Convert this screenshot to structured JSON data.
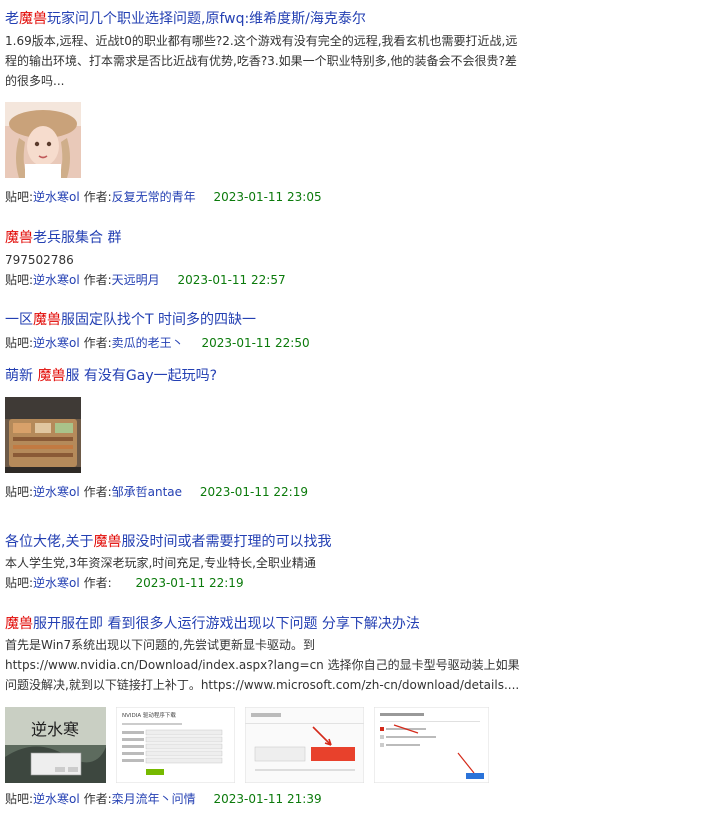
{
  "label_forum": "贴吧:",
  "label_author": "作者:",
  "posts": [
    {
      "title": [
        "老",
        "魔兽",
        "玩家问几个职业选择问题,原fwq:维希度斯/海克泰尔"
      ],
      "summary": "1.69版本,远程、近战t0的职业都有哪些?2.这个游戏有没有完全的远程,我看玄机也需要打近战,远程的输出环境、打本需求是否比近战有优势,吃香?3.如果一个职业特别多,他的装备会不会很贵?差的很多吗...",
      "forum": "逆水寒ol",
      "author": "反复无常的青年",
      "date": "2023-01-11 23:05"
    },
    {
      "title": [
        "",
        "魔兽",
        "老兵服集合 群"
      ],
      "summary": "797502786",
      "forum": "逆水寒ol",
      "author": "天远明月",
      "date": "2023-01-11 22:57"
    },
    {
      "title": [
        "一区",
        "魔兽",
        "服固定队找个T 时间多的四缺一"
      ],
      "summary": "",
      "forum": "逆水寒ol",
      "author": "卖瓜的老王丶",
      "date": "2023-01-11 22:50"
    },
    {
      "title": [
        "萌新 ",
        "魔兽",
        "服 有没有Gay一起玩吗?"
      ],
      "summary": "",
      "forum": "逆水寒ol",
      "author": "邹承哲antae",
      "date": "2023-01-11 22:19"
    },
    {
      "title": [
        "各位大佬,关于",
        "魔兽",
        "服没时间或者需要打理的可以找我"
      ],
      "summary": "本人学生党,3年资深老玩家,时间充足,专业特长,全职业精通",
      "forum": "逆水寒ol",
      "author": "",
      "date": "2023-01-11 22:19"
    },
    {
      "title": [
        "",
        "魔兽",
        "服开服在即 看到很多人运行游戏出现以下问题 分享下解决办法"
      ],
      "summary": "首先是Win7系统出现以下问题的,先尝试更新显卡驱动。到https://www.nvidia.cn/Download/index.aspx?lang=cn 选择你自己的显卡型号驱动装上如果问题没解决,就到以下链接打上补丁。https://www.microsoft.com/zh-cn/download/details....",
      "forum": "逆水寒ol",
      "author": "栾月流年丶问情",
      "date": "2023-01-11 21:39"
    }
  ],
  "screenshot_texts": {
    "game_logo": "逆水寒",
    "nvidia_title": "NVIDIA 驱动程序下载"
  },
  "colors": {
    "link": "#2440b3",
    "keyword": "#e10602",
    "date": "#0b7a0b",
    "text": "#333333"
  }
}
